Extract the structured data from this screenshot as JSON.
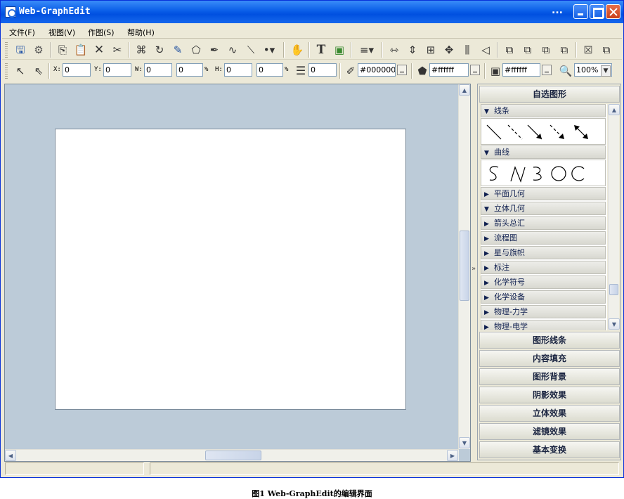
{
  "window": {
    "title": "Web-GraphEdit",
    "dots": "...",
    "minimize_icon": "minimize-icon",
    "maximize_icon": "maximize-icon",
    "close_icon": "close-icon"
  },
  "menu": [
    {
      "label": "文件(F)"
    },
    {
      "label": "视图(V)"
    },
    {
      "label": "作图(S)"
    },
    {
      "label": "帮助(H)"
    }
  ],
  "toolbar1": {
    "icons": [
      "save-icon",
      "settings-icon",
      "copy-icon",
      "paste-icon",
      "delete-icon",
      "cut-icon",
      "crop-icon",
      "rotate-icon",
      "pencil-icon",
      "polygon-icon",
      "pen-icon",
      "curve-icon",
      "line-icon",
      "point-icon",
      "hand-icon",
      "text-icon",
      "image-icon",
      "align-icon",
      "fit-width-icon",
      "fit-height-icon",
      "fit-both-icon",
      "move-icon",
      "flip-icon",
      "perspective-icon",
      "bring-front-icon",
      "send-back-icon",
      "bring-forward-icon",
      "send-backward-icon",
      "group-icon",
      "ungroup-icon"
    ]
  },
  "toolbar2": {
    "x_label": "X:",
    "x_value": "0",
    "y_label": "Y:",
    "y_value": "0",
    "w_label": "W:",
    "w_value": "0",
    "w_pct_value": "0",
    "pct_sign": "%",
    "h_label": "H:",
    "h_value": "0",
    "h_pct_value": "0",
    "line_width_value": "0",
    "stroke_color": "#000000",
    "fill_color": "#ffffff",
    "shadow_color": "#ffffff",
    "zoom": "100%"
  },
  "panel": {
    "title": "自选图形",
    "categories": [
      {
        "label": "线条",
        "expanded": true
      },
      {
        "label": "曲线",
        "expanded": true
      },
      {
        "label": "平面几何",
        "expanded": false
      },
      {
        "label": "立体几何",
        "expanded": true
      },
      {
        "label": "箭头总汇",
        "expanded": false
      },
      {
        "label": "流程图",
        "expanded": false
      },
      {
        "label": "星与旗帜",
        "expanded": false
      },
      {
        "label": "标注",
        "expanded": false
      },
      {
        "label": "化学符号",
        "expanded": false
      },
      {
        "label": "化学设备",
        "expanded": false
      },
      {
        "label": "物理-力学",
        "expanded": false
      },
      {
        "label": "物理-电学",
        "expanded": false
      }
    ],
    "sections": [
      "图形线条",
      "内容填充",
      "图形背景",
      "阴影效果",
      "立体效果",
      "滤镜效果",
      "基本变换"
    ]
  },
  "caption": "图1   Web-GraphEdit的编辑界面",
  "colors": {
    "titlebar": "#0a5ee8",
    "canvas_bg": "#bccbd8",
    "paper": "#ffffff",
    "chrome": "#ece9d8"
  }
}
